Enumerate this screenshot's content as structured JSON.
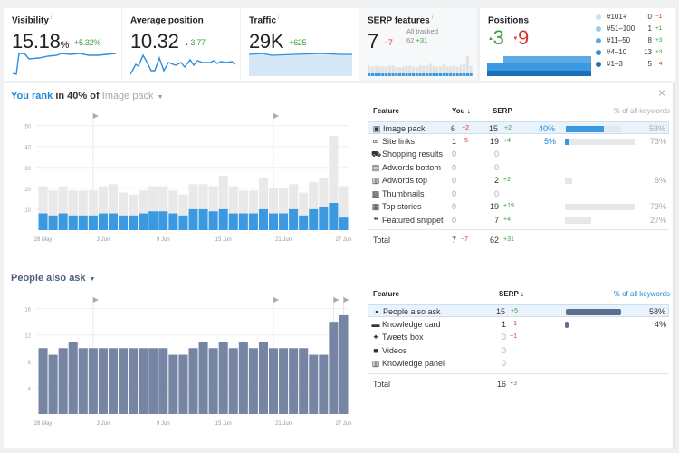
{
  "metrics": {
    "visibility": {
      "title": "Visibility",
      "value": "15.18",
      "unit": "%",
      "delta": "+5.32%"
    },
    "avg_position": {
      "title": "Average position",
      "value": "10.32",
      "delta": "3.77",
      "delta_arrow": "▲"
    },
    "traffic": {
      "title": "Traffic",
      "value": "29K",
      "delta": "+625"
    },
    "serp_features": {
      "title": "SERP features",
      "value": "7",
      "delta": "−7",
      "all_tracked_label": "All tracked",
      "all_tracked_value": "62",
      "all_tracked_delta": "+31"
    },
    "positions": {
      "title": "Positions",
      "up": "3",
      "up_arrow": "▲",
      "down": "9",
      "down_arrow": "▼",
      "legend": [
        {
          "label": "#101+",
          "value": "0",
          "delta": "−1",
          "delta_type": "neg",
          "color": "#c9e2f5"
        },
        {
          "label": "#51–100",
          "value": "1",
          "delta": "+1",
          "delta_type": "pos",
          "color": "#9ccbee"
        },
        {
          "label": "#11–50",
          "value": "8",
          "delta": "+3",
          "delta_type": "pos",
          "color": "#5eaae5"
        },
        {
          "label": "#4–10",
          "value": "13",
          "delta": "+3",
          "delta_type": "pos",
          "color": "#2f8edb"
        },
        {
          "label": "#1–3",
          "value": "5",
          "delta": "−4",
          "delta_type": "neg",
          "color": "#1b6fb5"
        }
      ]
    },
    "info_icon": "i"
  },
  "image_pack": {
    "title_prefix": "You rank",
    "title_middle": "in 40% of",
    "title_feature": "Image pack",
    "close_icon": "×",
    "table": {
      "headers": {
        "feature": "Feature",
        "you": "You ↓",
        "serp": "SERP",
        "pct": "% of all keywords"
      },
      "rows": [
        {
          "icon": "image-icon",
          "glyph": "▣",
          "feature": "Image pack",
          "you": "6",
          "you_delta": "−2",
          "you_delta_type": "neg",
          "serp": "15",
          "serp_delta": "+2",
          "serp_delta_type": "pos",
          "you_pct": "40%",
          "you_frac": 0.4,
          "pct": "58%",
          "frac": 0.58,
          "highlight": true
        },
        {
          "icon": "link-icon",
          "glyph": "∞",
          "feature": "Site links",
          "you": "1",
          "you_delta": "−5",
          "you_delta_type": "neg",
          "serp": "19",
          "serp_delta": "+4",
          "serp_delta_type": "pos",
          "you_pct": "5%",
          "you_frac": 0.05,
          "pct": "73%",
          "frac": 0.73
        },
        {
          "icon": "cart-icon",
          "glyph": "⛟",
          "feature": "Shopping results",
          "you": "0",
          "serp": "0"
        },
        {
          "icon": "ad-icon",
          "glyph": "▤",
          "feature": "Adwords bottom",
          "you": "0",
          "serp": "0"
        },
        {
          "icon": "ad-icon",
          "glyph": "▥",
          "feature": "Adwords top",
          "you": "0",
          "serp": "2",
          "serp_delta": "+2",
          "serp_delta_type": "pos",
          "pct": "8%",
          "frac": 0.08
        },
        {
          "icon": "thumbnail-icon",
          "glyph": "▩",
          "feature": "Thumbnails",
          "you": "0",
          "serp": "0"
        },
        {
          "icon": "news-icon",
          "glyph": "▦",
          "feature": "Top stories",
          "you": "0",
          "serp": "19",
          "serp_delta": "+19",
          "serp_delta_type": "pos",
          "pct": "73%",
          "frac": 0.73
        },
        {
          "icon": "quote-icon",
          "glyph": "❝",
          "feature": "Featured snippet",
          "you": "0",
          "serp": "7",
          "serp_delta": "+4",
          "serp_delta_type": "pos",
          "pct": "27%",
          "frac": 0.27
        }
      ],
      "total": {
        "label": "Total",
        "you": "7",
        "you_delta": "−7",
        "serp": "62",
        "serp_delta": "+31"
      }
    }
  },
  "people_also_ask": {
    "title": "People also ask",
    "table": {
      "headers": {
        "feature": "Feature",
        "serp": "SERP ↓",
        "pct": "% of all keywords"
      },
      "rows": [
        {
          "icon": "question-icon",
          "glyph": "▪",
          "feature": "People also ask",
          "serp": "15",
          "serp_delta": "+5",
          "serp_delta_type": "pos",
          "pct": "58%",
          "frac": 0.58,
          "highlight": true
        },
        {
          "icon": "card-icon",
          "glyph": "▬",
          "feature": "Knowledge card",
          "serp": "1",
          "serp_delta": "−1",
          "serp_delta_type": "neg",
          "pct": "4%",
          "frac": 0.04
        },
        {
          "icon": "twitter-icon",
          "glyph": "✦",
          "feature": "Tweets box",
          "serp": "0",
          "serp_delta": "−1",
          "serp_delta_type": "neg"
        },
        {
          "icon": "video-icon",
          "glyph": "■",
          "feature": "Videos",
          "serp": "0"
        },
        {
          "icon": "panel-icon",
          "glyph": "▥",
          "feature": "Knowledge panel",
          "serp": "0"
        }
      ],
      "total": {
        "label": "Total",
        "serp": "16",
        "serp_delta": "+3"
      }
    }
  },
  "chart_data": [
    {
      "type": "bar",
      "title": "You rank in 40% of Image pack",
      "x_tick_labels": [
        "28 May",
        "3 Jun",
        "9 Jun",
        "15 Jun",
        "21 Jun",
        "27 Jun"
      ],
      "y_ticks": [
        10,
        20,
        30,
        40,
        50
      ],
      "ylim": [
        0,
        52
      ],
      "grid": true,
      "series": [
        {
          "name": "SERP",
          "color": "#e9e9e9",
          "values": [
            21,
            19,
            21,
            19,
            19,
            19,
            21,
            22,
            18,
            17,
            19,
            21,
            21,
            19,
            17,
            22,
            22,
            21,
            26,
            21,
            19,
            19,
            25,
            20,
            20,
            22,
            18,
            23,
            25,
            45,
            21
          ]
        },
        {
          "name": "You",
          "color": "#3a99e0",
          "values": [
            8,
            7,
            8,
            7,
            7,
            7,
            8,
            8,
            7,
            7,
            8,
            9,
            9,
            8,
            7,
            10,
            10,
            9,
            10,
            8,
            8,
            8,
            10,
            8,
            8,
            10,
            7,
            10,
            11,
            13,
            6
          ]
        }
      ],
      "annotation_flags": [
        6,
        24
      ]
    },
    {
      "type": "bar",
      "title": "People also ask",
      "x_tick_labels": [
        "28 May",
        "3 Jun",
        "9 Jun",
        "15 Jun",
        "21 Jun",
        "27 Jun"
      ],
      "y_ticks": [
        4,
        8,
        12,
        16
      ],
      "ylim": [
        0,
        16.5
      ],
      "grid": true,
      "series": [
        {
          "name": "SERP",
          "color": "#7585a3",
          "values": [
            10,
            9,
            10,
            11,
            10,
            10,
            10,
            10,
            10,
            10,
            10,
            10,
            10,
            9,
            9,
            10,
            11,
            10,
            11,
            10,
            11,
            10,
            11,
            10,
            10,
            10,
            10,
            9,
            9,
            14,
            15
          ]
        }
      ],
      "annotation_flags": [
        6,
        24,
        30,
        31
      ]
    }
  ]
}
